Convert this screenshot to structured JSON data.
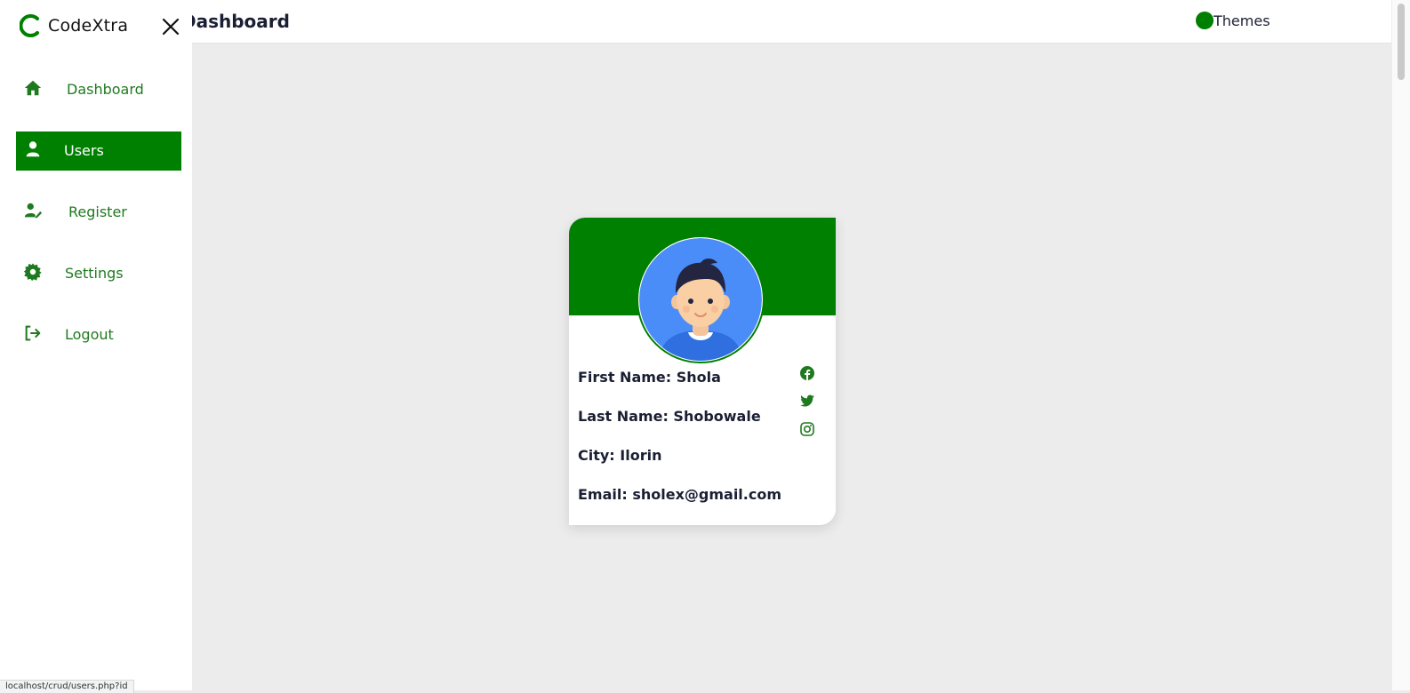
{
  "header": {
    "page_title": "Dashboard",
    "theme_label": "Themes",
    "accent": "#008000"
  },
  "sidebar": {
    "brand": "CodeXtra",
    "items": [
      {
        "label": "Dashboard",
        "icon": "home-icon",
        "active": false
      },
      {
        "label": "Users",
        "icon": "user-icon",
        "active": true
      },
      {
        "label": "Register",
        "icon": "user-edit-icon",
        "active": false
      },
      {
        "label": "Settings",
        "icon": "gear-icon",
        "active": false
      },
      {
        "label": "Logout",
        "icon": "logout-icon",
        "active": false
      }
    ]
  },
  "profile": {
    "first_name": "First Name: Shola",
    "last_name": "Last Name: Shobowale",
    "city": "City: Ilorin",
    "email": "Email: sholex@gmail.com",
    "social": [
      "facebook-icon",
      "twitter-icon",
      "instagram-icon"
    ]
  },
  "status_bar": {
    "url": "localhost/crud/users.php?id"
  }
}
